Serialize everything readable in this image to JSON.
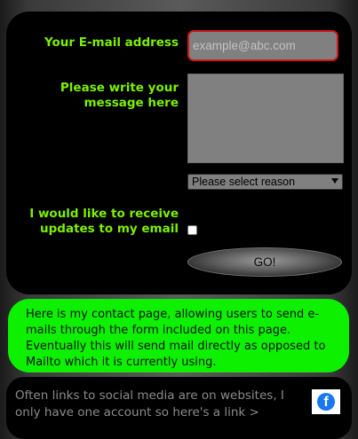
{
  "form": {
    "email_label": "Your E-mail address",
    "email_placeholder": "example@abc.com",
    "message_label": "Please write your message here",
    "message_value": "",
    "reason_selected": "Please select reason",
    "updates_label": "I would like to receive updates to my email",
    "updates_checked": false,
    "submit_label": "GO!"
  },
  "info": {
    "text": "Here is my contact page, allowing users to send e-mails through the form included on this page. Eventually this will send mail directly as opposed to Mailto which it is currently using."
  },
  "social": {
    "text": "Often links to social media are on websites, I only have one account so here's a link >",
    "icon": "facebook-icon",
    "icon_letter": "f"
  },
  "colors": {
    "label_green": "#7cf000",
    "info_green": "#0df000",
    "panel_black": "#000000",
    "input_grey": "#808080",
    "input_border_red": "#d01818",
    "facebook_blue": "#1877f2"
  }
}
